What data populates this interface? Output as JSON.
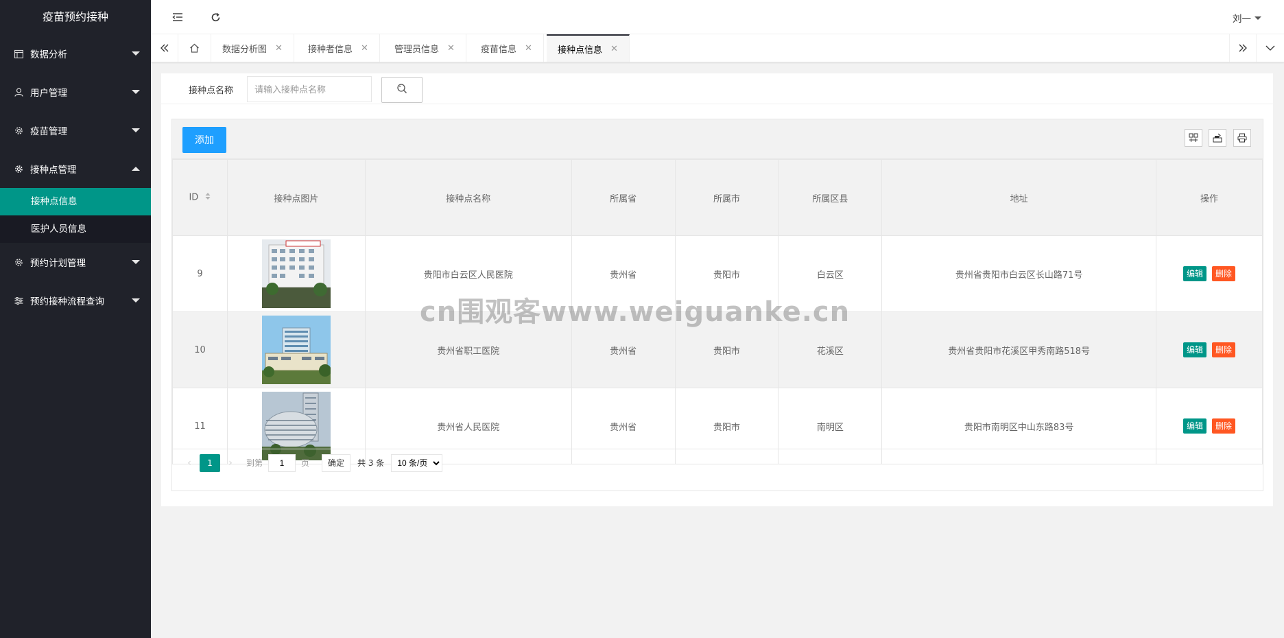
{
  "app": {
    "title": "疫苗预约接种"
  },
  "sidebar": {
    "items": [
      {
        "label": "数据分析",
        "icon": "calendar-icon"
      },
      {
        "label": "用户管理",
        "icon": "user-icon"
      },
      {
        "label": "疫苗管理",
        "icon": "gear-icon"
      },
      {
        "label": "接种点管理",
        "icon": "gear-icon",
        "expanded": true
      },
      {
        "label": "预约计划管理",
        "icon": "gear-icon"
      },
      {
        "label": "预约接种流程查询",
        "icon": "sliders-icon"
      }
    ],
    "subitems": [
      {
        "label": "接种点信息",
        "active": true
      },
      {
        "label": "医护人员信息"
      }
    ]
  },
  "header": {
    "user": "刘一"
  },
  "tabs": [
    {
      "label": "数据分析图"
    },
    {
      "label": "接种者信息"
    },
    {
      "label": "管理员信息"
    },
    {
      "label": "疫苗信息"
    },
    {
      "label": "接种点信息",
      "active": true
    }
  ],
  "search": {
    "label": "接种点名称",
    "placeholder": "请输入接种点名称"
  },
  "toolbar": {
    "add_label": "添加"
  },
  "table": {
    "columns": [
      "ID",
      "接种点图片",
      "接种点名称",
      "所属省",
      "所属市",
      "所属区县",
      "地址",
      "操作"
    ],
    "rows": [
      {
        "id": "9",
        "name": "贵阳市白云区人民医院",
        "province": "贵州省",
        "city": "贵阳市",
        "district": "白云区",
        "address": "贵州省贵阳市白云区长山路71号"
      },
      {
        "id": "10",
        "name": "贵州省职工医院",
        "province": "贵州省",
        "city": "贵阳市",
        "district": "花溪区",
        "address": "贵州省贵阳市花溪区甲秀南路518号"
      },
      {
        "id": "11",
        "name": "贵州省人民医院",
        "province": "贵州省",
        "city": "贵阳市",
        "district": "南明区",
        "address": "贵阳市南明区中山东路83号"
      }
    ],
    "edit_label": "编辑",
    "delete_label": "删除"
  },
  "pager": {
    "current": "1",
    "goto_label": "到第",
    "goto_value": "1",
    "page_label": "页",
    "confirm_label": "确定",
    "total": "共 3 条",
    "page_size": "10 条/页"
  },
  "watermark": "cn围观客www.weiguanke.cn",
  "colors": {
    "sidebar": "#20222a",
    "accent": "#009688",
    "primary": "#1e9fff",
    "danger": "#ff5722"
  }
}
